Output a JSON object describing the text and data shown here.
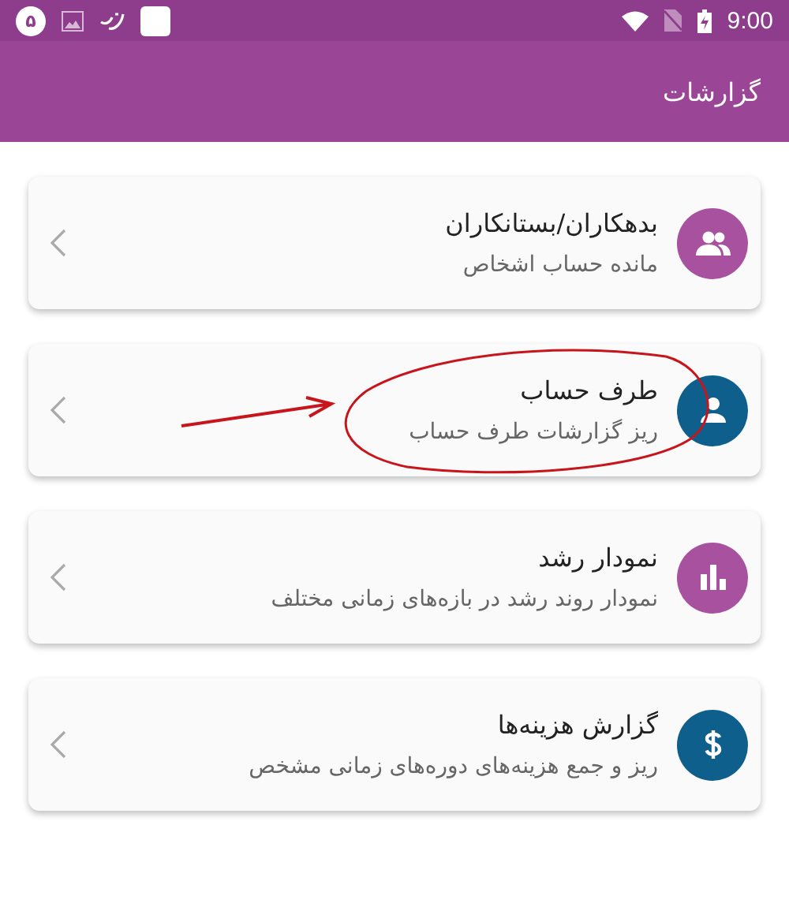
{
  "status_bar": {
    "badge": "۵",
    "time": "9:00"
  },
  "app_bar": {
    "title": "گزارشات"
  },
  "reports": [
    {
      "title": "بدهکاران/بستانکاران",
      "subtitle": "مانده حساب اشخاص",
      "kind": "people",
      "color": "#a8519f",
      "annotated": false
    },
    {
      "title": "طرف حساب",
      "subtitle": "ریز گزارشات طرف حساب",
      "kind": "person",
      "color": "#0f5f8c",
      "annotated": true
    },
    {
      "title": "نمودار رشد",
      "subtitle": "نمودار روند رشد در بازه‌های زمانی مختلف",
      "kind": "chart",
      "color": "#a8519f",
      "annotated": false
    },
    {
      "title": "گزارش هزینه‌ها",
      "subtitle": "ریز و جمع هزینه‌های دوره‌های زمانی مشخص",
      "kind": "dollar",
      "color": "#0f5f8c",
      "annotated": false
    }
  ]
}
